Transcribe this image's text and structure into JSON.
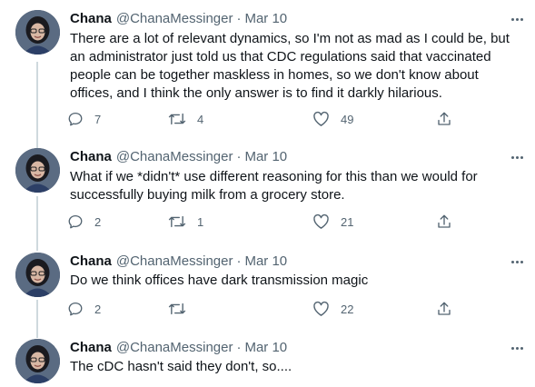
{
  "tweets": [
    {
      "name": "Chana",
      "handle": "@ChanaMessinger",
      "separator": "·",
      "date": "Mar 10",
      "text": "There are a lot of relevant dynamics, so I'm not as mad as I could be, but an administrator just told us that CDC regulations said that vaccinated people can be together maskless in homes, so we don't know about offices, and I think the only answer is to find it darkly hilarious.",
      "replies": "7",
      "retweets": "4",
      "likes": "49"
    },
    {
      "name": "Chana",
      "handle": "@ChanaMessinger",
      "separator": "·",
      "date": "Mar 10",
      "text": "What if we *didn't* use different reasoning for this than we would for successfully buying milk from a grocery store.",
      "replies": "2",
      "retweets": "1",
      "likes": "21"
    },
    {
      "name": "Chana",
      "handle": "@ChanaMessinger",
      "separator": "·",
      "date": "Mar 10",
      "text": "Do we think offices have dark transmission magic",
      "replies": "2",
      "retweets": "",
      "likes": "22"
    },
    {
      "name": "Chana",
      "handle": "@ChanaMessinger",
      "separator": "·",
      "date": "Mar 10",
      "text": "The cDC hasn't said they don't, so....",
      "replies": "",
      "retweets": "",
      "likes": ""
    }
  ]
}
